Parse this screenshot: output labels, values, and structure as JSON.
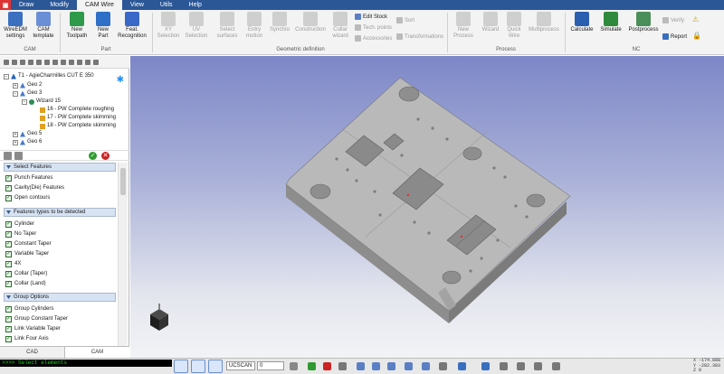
{
  "menu": {
    "app_icon": "app-logo",
    "tabs": [
      "Draw",
      "Modify",
      "CAM Wire",
      "View",
      "Utils",
      "Help"
    ],
    "active": "CAM Wire"
  },
  "ribbon": {
    "cam_group": {
      "label": "CAM",
      "wireedm": "WireEDM\nsettings",
      "cam_template": "CAM\ntemplate"
    },
    "part_group": {
      "label": "Part",
      "new_toolpath": "New\nToolpath",
      "new_part": "New\nPart",
      "feat_recognition": "Feat.\nRecognition"
    },
    "geo_group": {
      "label": "Geometric definition",
      "xy_selection": "XY\nSelection",
      "uv_selection": "UV\nSelection",
      "select_surfaces": "Select\nsurfaces",
      "entry_motion": "Entry\nmotion",
      "synchro": "Synchro",
      "construction": "Construction",
      "collar_wizard": "Collar\nwizard"
    },
    "small": {
      "edit_stock": "Edit Stock",
      "tech_points": "Tech. points",
      "accessories": "Accessories",
      "sort": "Sort",
      "transformations": "Transformations"
    },
    "process_group": {
      "label": "Process",
      "new_process": "New\nProcess",
      "wizard": "Wizard",
      "quick_wire": "Quick\nWire",
      "multiprocess": "Multiprocess"
    },
    "nc_group": {
      "label": "NC",
      "calculate": "Calculate",
      "simulate": "Simulate",
      "postprocess": "Postprocess",
      "verify": "Verify",
      "report": "Report"
    }
  },
  "tree": {
    "root": "T1 - AgieCharmilles CUT E 350",
    "items": [
      "Geo 2",
      "Geo 3",
      "Wizard 15",
      "16 - PW Complete roughing",
      "17 - PW Complete skimming",
      "18 - PW Complete skimming",
      "Geo 5",
      "Geo 6"
    ]
  },
  "panel": {
    "select_features": {
      "title": "Select Features",
      "items": [
        "Punch Features",
        "Cavity(Die) Features",
        "Open contours"
      ]
    },
    "features_types": {
      "title": "Features types to be detected",
      "items": [
        "Cylinder",
        "No Taper",
        "Constant Taper",
        "Variable Taper",
        "4X",
        "Collar (Taper)",
        "Collar (Land)"
      ]
    },
    "group_options": {
      "title": "Group Options",
      "items": [
        "Group Cylinders",
        "Group Constant Taper",
        "Link Variable Taper",
        "Link Four Axis"
      ]
    }
  },
  "bottom_tabs": [
    "CAD",
    "CAM"
  ],
  "bottom_active": "CAM",
  "status": {
    "command_text": ">>>> Select elements",
    "ucs_combo": "UCSCAN",
    "layer_combo": "0",
    "coords": [
      "X -174.888",
      "Y -282.383",
      "Z 0"
    ]
  },
  "colors": {
    "menubar": "#2b5797",
    "viewport_top": "#7d87c7",
    "part_top": "#b9b9b9",
    "cmd_text": "#26d026"
  }
}
